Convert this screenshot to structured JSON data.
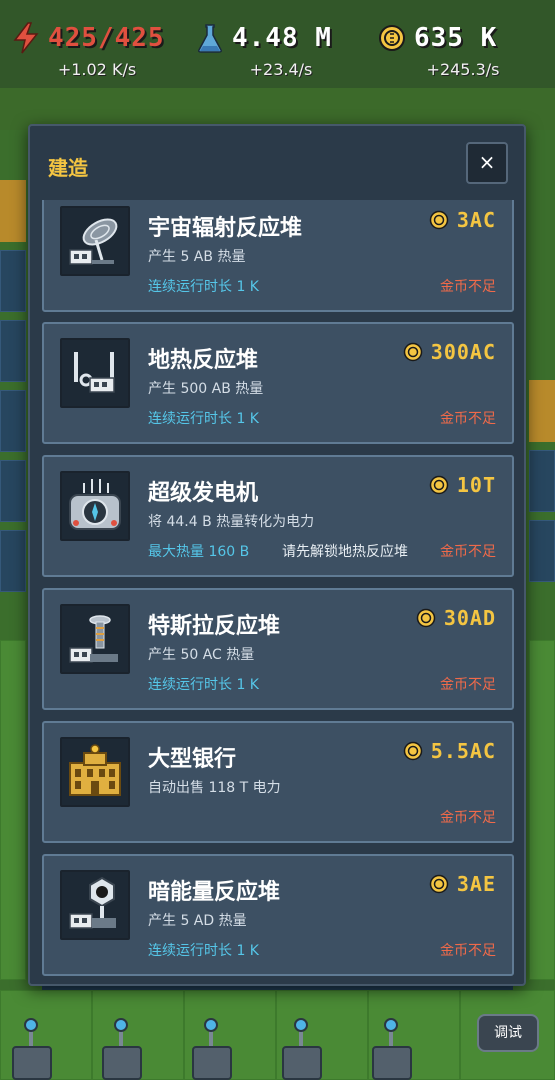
{
  "resources": {
    "power": {
      "value": "425/425",
      "rate": "+1.02 K/s",
      "icon": "lightning-bolt-icon"
    },
    "heat": {
      "value": "4.48 M",
      "rate": "+23.4/s",
      "icon": "flask-icon"
    },
    "money": {
      "value": "635 K",
      "rate": "+245.3/s",
      "icon": "coin-icon"
    }
  },
  "dialog": {
    "title": "建造",
    "close_label": "×"
  },
  "items": [
    {
      "name": "宇宙辐射反应堆",
      "desc": "产生 5 AB 热量",
      "extra": "连续运行时长 1 K",
      "requirement": "",
      "price": "3AC",
      "status": "金币不足",
      "icon": "cosmic-radiation-reactor-icon"
    },
    {
      "name": "地热反应堆",
      "desc": "产生 500 AB 热量",
      "extra": "连续运行时长 1 K",
      "requirement": "",
      "price": "300AC",
      "status": "金币不足",
      "icon": "geothermal-reactor-icon"
    },
    {
      "name": "超级发电机",
      "desc": "将 44.4 B 热量转化为电力",
      "extra": "最大热量 160 B",
      "requirement": "请先解锁地热反应堆",
      "price": "10T",
      "status": "金币不足",
      "icon": "super-generator-icon"
    },
    {
      "name": "特斯拉反应堆",
      "desc": "产生 50 AC 热量",
      "extra": "连续运行时长 1 K",
      "requirement": "",
      "price": "30AD",
      "status": "金币不足",
      "icon": "tesla-reactor-icon"
    },
    {
      "name": "大型银行",
      "desc": "自动出售 118 T 电力",
      "extra": "",
      "requirement": "",
      "price": "5.5AC",
      "status": "金币不足",
      "icon": "large-bank-icon"
    },
    {
      "name": "暗能量反应堆",
      "desc": "产生 5 AD 热量",
      "extra": "连续运行时长 1 K",
      "requirement": "",
      "price": "3AE",
      "status": "金币不足",
      "icon": "dark-energy-reactor-icon"
    }
  ],
  "debug_label": "调试",
  "colors": {
    "accent": "#f4c542",
    "power": "#e0503f",
    "link": "#55c6e8",
    "warning": "#f06a4a",
    "panel": "#2b3a49",
    "card": "#3d5063"
  }
}
